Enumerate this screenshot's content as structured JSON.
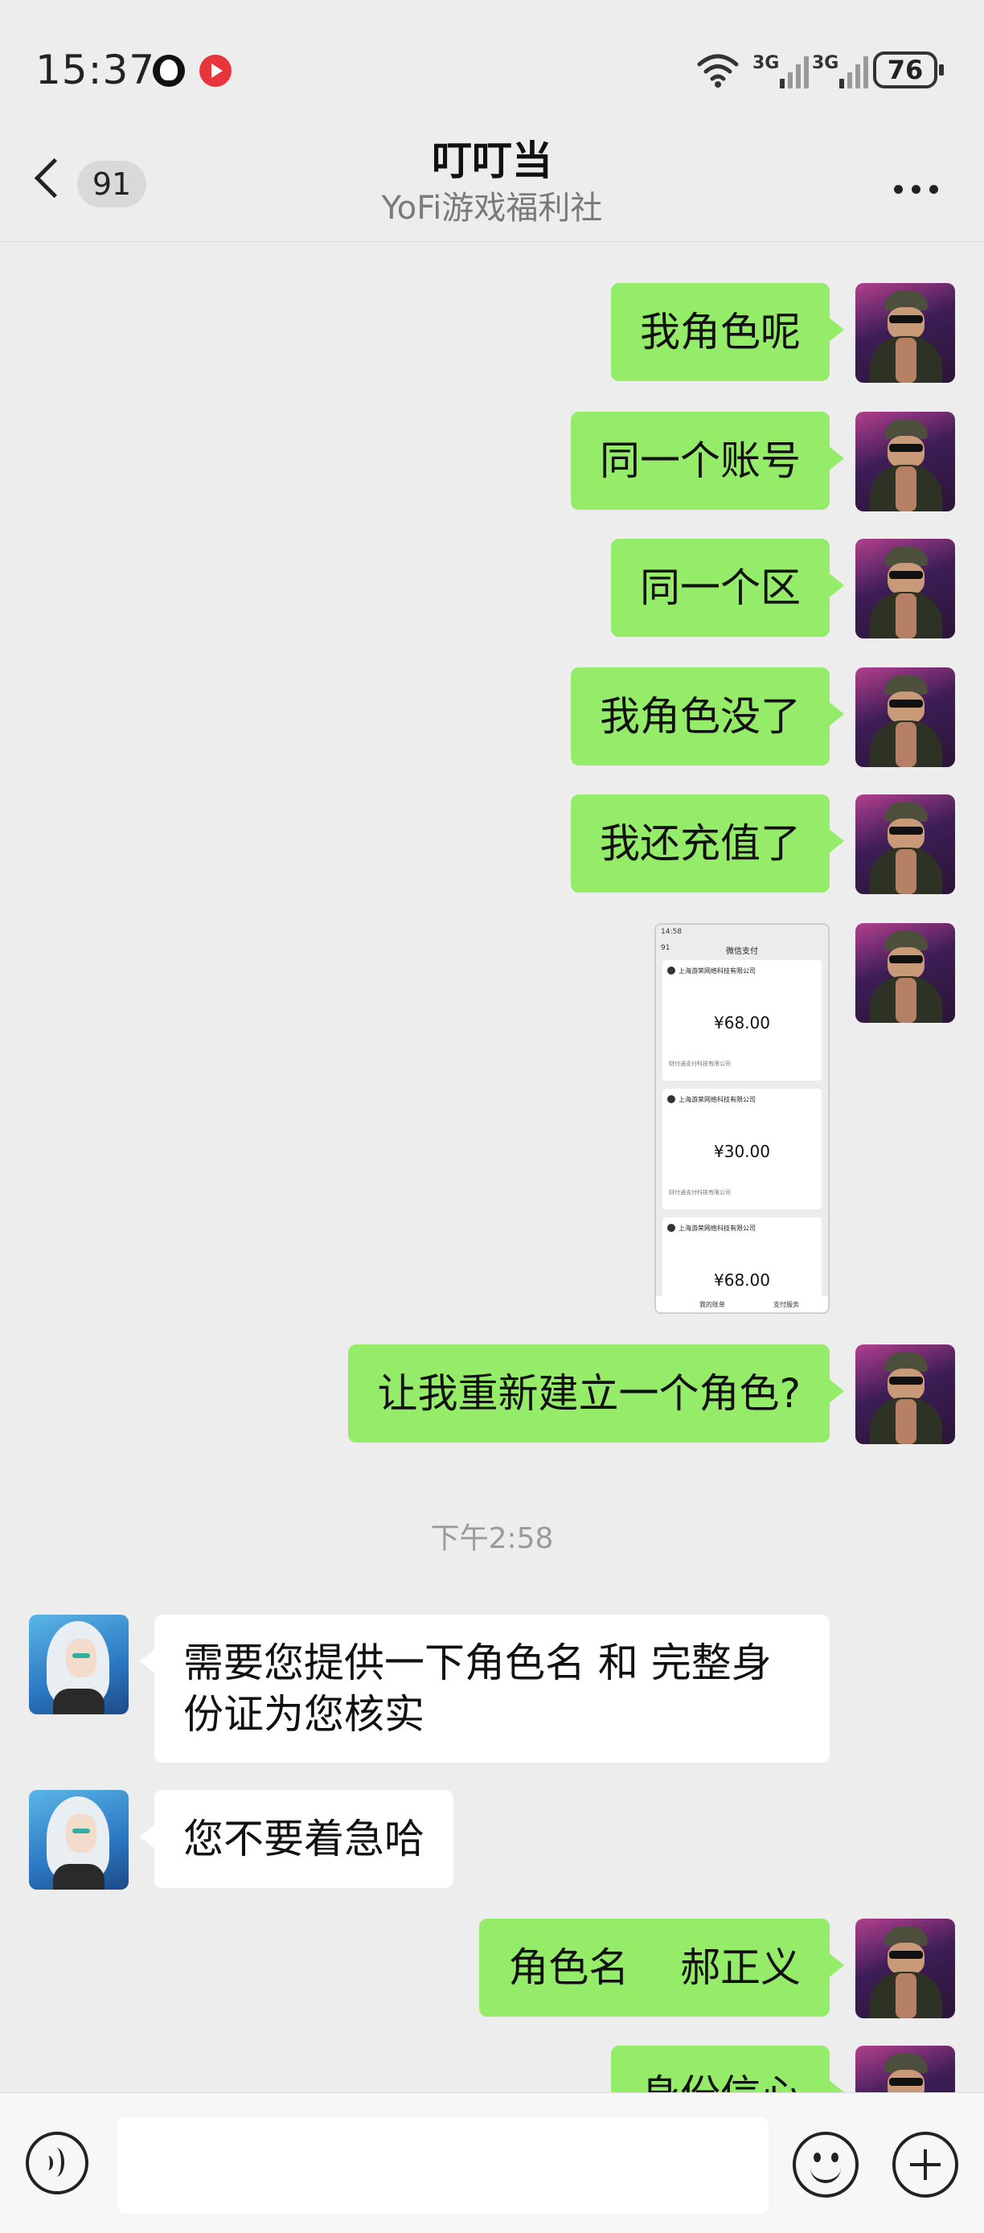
{
  "status_bar": {
    "time": "15:37",
    "network1": "3G",
    "network2": "3G",
    "battery": "76"
  },
  "header": {
    "back_count": "91",
    "title": "叮叮当",
    "subtitle": "YoFi游戏福利社"
  },
  "messages": {
    "m1": "我角色呢",
    "m2": "同一个账号",
    "m3": "同一个区",
    "m4": "我角色没了",
    "m5": "我还充值了",
    "m7": "让我重新建立一个角色?",
    "m8": "需要您提供一下角色名 和 完整身份证为您核实",
    "m9": "您不要着急哈",
    "m10": "角色名    郝正义",
    "m11": "身份信心"
  },
  "timestamp": "下午2:58",
  "payment_screenshot": {
    "status_time": "14:58",
    "back_count": "91",
    "title": "微信支付",
    "records": [
      {
        "merchant": "上海游荣网络科技有限公司",
        "amount": "¥68.00",
        "payee": "财付通支付科技有限公司"
      },
      {
        "merchant": "上海游荣网络科技有限公司",
        "amount": "¥30.00",
        "payee": "财付通支付科技有限公司"
      },
      {
        "merchant": "上海游荣网络科技有限公司",
        "amount": "¥68.00",
        "payee": ""
      }
    ],
    "footer_left": "我的账单",
    "footer_right": "支付服务"
  },
  "input": {
    "value": "",
    "placeholder": ""
  }
}
